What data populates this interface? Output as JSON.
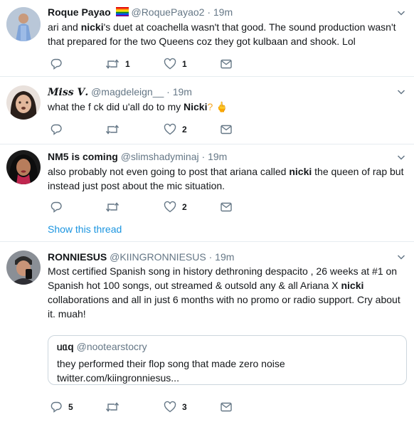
{
  "tweets": [
    {
      "name": "Roque Payao",
      "flag": "🏳️‍🌈",
      "handle": "@RoquePayao2",
      "dot": "·",
      "time": "19m",
      "text_parts": [
        "ari and ",
        "nicki",
        "'s duet at coachella wasn't that good. The sound production wasn't that prepared for the two Queens coz they got kulbaan and shook. Lol"
      ],
      "replies": "",
      "retweets": "1",
      "likes": "1"
    },
    {
      "name": "𝑴𝒊𝒔𝒔 𝑽.",
      "handle": "@magdeleign__",
      "dot": "·",
      "time": "19m",
      "text_parts": [
        "what the f  ck did u'all do to my ",
        "Nicki",
        "? 🖕"
      ],
      "replies": "",
      "retweets": "",
      "likes": "2"
    },
    {
      "name": "NM5 is coming",
      "handle": "@slimshadyminaj",
      "dot": "·",
      "time": "19m",
      "text_parts": [
        "also probably not even going to post that ariana called ",
        "nicki",
        " the queen of rap but instead just post about the mic situation."
      ],
      "replies": "",
      "retweets": "",
      "likes": "2",
      "show_thread": "Show this thread"
    },
    {
      "name": "RONNIESUS",
      "handle": "@KIINGRONNIESUS",
      "dot": "·",
      "time": "19m",
      "text_parts": [
        "Most certified Spanish song in history dethroning despacito , 26 weeks at #1 on Spanish hot 100 songs, out streamed & outsold any & all Ariana X ",
        "nicki",
        " collaborations and all in just 6 months with no promo or radio support. Cry about it. muah!"
      ],
      "replies": "5",
      "retweets": "",
      "likes": "3",
      "quote": {
        "name": "ᥙᥲq",
        "handle": "@nootearstocry",
        "line1": "they performed their flop song that made zero noise",
        "line2": "twitter.com/kiingronniesus..."
      }
    }
  ],
  "colors": {
    "name": "#14171a",
    "secondary": "#657786",
    "link": "#1b95e0",
    "border": "#e6ecf0"
  },
  "icons": [
    "reply-icon",
    "retweet-icon",
    "like-icon",
    "dm-icon",
    "caret-down-icon"
  ]
}
